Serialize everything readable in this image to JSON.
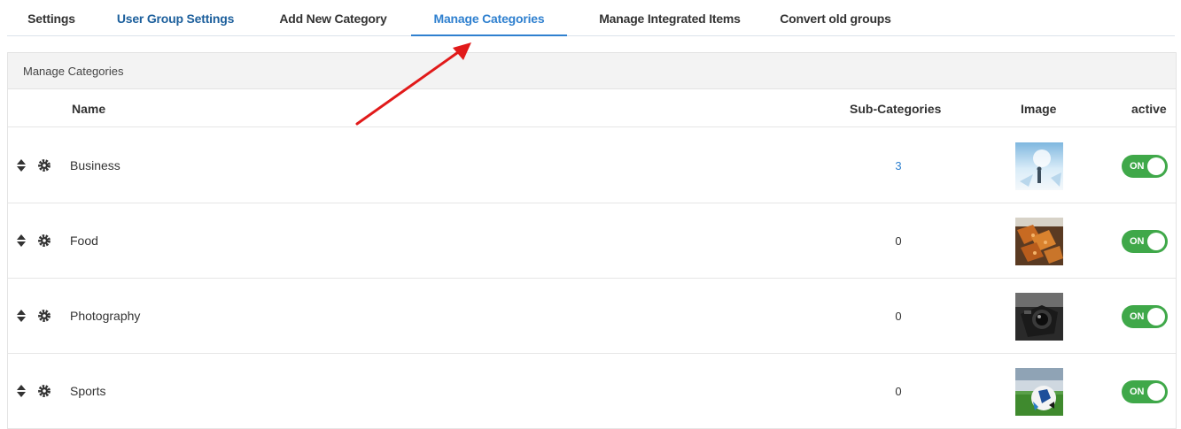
{
  "tabs": [
    {
      "label": "Settings"
    },
    {
      "label": "User Group Settings"
    },
    {
      "label": "Add New Category"
    },
    {
      "label": "Manage Categories"
    },
    {
      "label": "Manage Integrated Items"
    },
    {
      "label": "Convert old groups"
    }
  ],
  "active_tab": "Manage Categories",
  "panel": {
    "title": "Manage Categories",
    "columns": {
      "name": "Name",
      "subcategories": "Sub-Categories",
      "image": "Image",
      "active": "active"
    }
  },
  "categories": [
    {
      "name": "Business",
      "subcategories": "3",
      "image_icon": "business-photo",
      "toggle": "ON"
    },
    {
      "name": "Food",
      "subcategories": "0",
      "image_icon": "food-photo",
      "toggle": "ON"
    },
    {
      "name": "Photography",
      "subcategories": "0",
      "image_icon": "camera-photo",
      "toggle": "ON"
    },
    {
      "name": "Sports",
      "subcategories": "0",
      "image_icon": "soccer-ball-photo",
      "toggle": "ON"
    }
  ],
  "colors": {
    "active_tab": "#2f80cf",
    "link_tab": "#1c5f9c",
    "toggle_on": "#3fa849",
    "annotation_arrow": "#e11a1a"
  }
}
